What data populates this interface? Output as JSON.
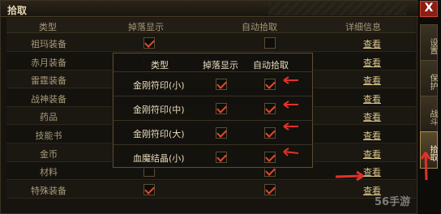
{
  "window": {
    "title": "拾取",
    "close_label": "X"
  },
  "table": {
    "headers": {
      "type": "类型",
      "show": "掉落显示",
      "auto": "自动拾取",
      "detail": "详细信息"
    },
    "rows": [
      {
        "name": "祖玛装备",
        "show": true,
        "auto": false,
        "detail": "查看"
      },
      {
        "name": "赤月装备",
        "show": false,
        "auto": false,
        "detail": "查看"
      },
      {
        "name": "雷霆装备",
        "show": false,
        "auto": false,
        "detail": "查看"
      },
      {
        "name": "战神装备",
        "show": false,
        "auto": false,
        "detail": "查看"
      },
      {
        "name": "药品",
        "show": false,
        "auto": false,
        "detail": "查看"
      },
      {
        "name": "技能书",
        "show": false,
        "auto": false,
        "detail": "查看"
      },
      {
        "name": "金币",
        "show": false,
        "auto": false,
        "detail": "查看"
      },
      {
        "name": "材料",
        "show": false,
        "auto": true,
        "detail": "查看"
      },
      {
        "name": "特殊装备",
        "show": true,
        "auto": true,
        "detail": "查看"
      }
    ]
  },
  "popup": {
    "headers": {
      "type": "类型",
      "show": "掉落显示",
      "auto": "自动拾取"
    },
    "rows": [
      {
        "name": "金刚符印(小)",
        "show": true,
        "auto": true
      },
      {
        "name": "金刚符印(中)",
        "show": true,
        "auto": true
      },
      {
        "name": "金刚符印(大)",
        "show": true,
        "auto": true
      },
      {
        "name": "血魔结晶(小)",
        "show": true,
        "auto": true
      }
    ]
  },
  "side_tabs": [
    {
      "label": "设置",
      "active": false
    },
    {
      "label": "保护",
      "active": false
    },
    {
      "label": "战斗",
      "active": false
    },
    {
      "label": "拾取",
      "active": true
    }
  ],
  "watermark": "56手游",
  "colors": {
    "accent": "#e14a2c",
    "link": "#d9c48a"
  }
}
